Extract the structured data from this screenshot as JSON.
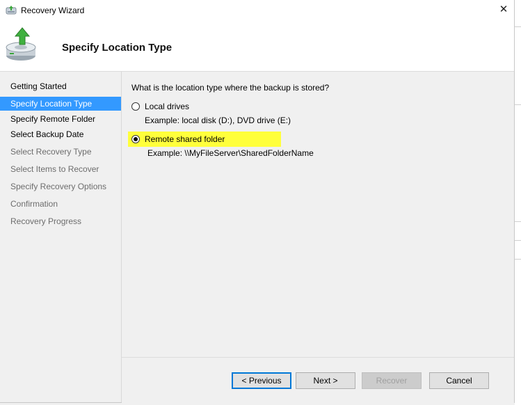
{
  "window": {
    "title": "Recovery Wizard",
    "close_glyph": "✕"
  },
  "header": {
    "title": "Specify Location Type",
    "icon": "backup-restore-icon"
  },
  "sidebar": {
    "steps": [
      {
        "label": "Getting Started",
        "state": "normal"
      },
      {
        "label": "Specify Location Type",
        "state": "active"
      },
      {
        "label": "Specify Remote Folder",
        "state": "normal"
      },
      {
        "label": "Select Backup Date",
        "state": "normal"
      },
      {
        "label": "Select Recovery Type",
        "state": "disabled"
      },
      {
        "label": "Select Items to Recover",
        "state": "disabled"
      },
      {
        "label": "Specify Recovery Options",
        "state": "disabled"
      },
      {
        "label": "Confirmation",
        "state": "disabled"
      },
      {
        "label": "Recovery Progress",
        "state": "disabled"
      }
    ]
  },
  "content": {
    "question": "What is the location type where the backup is stored?",
    "options": [
      {
        "label": "Local drives",
        "example": "Example: local disk (D:), DVD drive (E:)",
        "selected": false
      },
      {
        "label": "Remote shared folder",
        "example": "Example: \\\\MyFileServer\\SharedFolderName",
        "selected": true
      }
    ]
  },
  "footer": {
    "previous": "< Previous",
    "next": "Next >",
    "recover": "Recover",
    "cancel": "Cancel"
  },
  "colors": {
    "accent": "#3399ff",
    "highlight": "#ffff3b",
    "focus": "#0078d7"
  }
}
